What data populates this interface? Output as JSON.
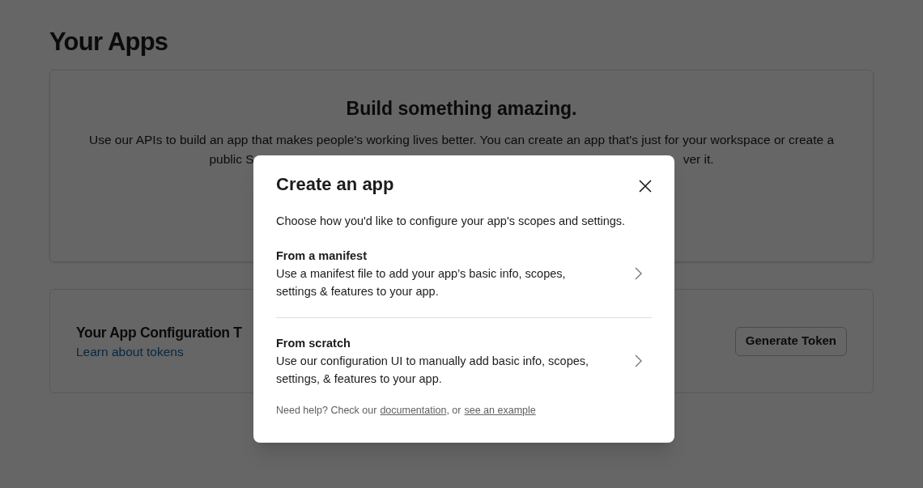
{
  "page": {
    "title": "Your Apps"
  },
  "intro_card": {
    "heading": "Build something amazing.",
    "text_line_1": "Use our APIs to build an app that makes people's working lives better. You can create an app that's just for your workspace or create a",
    "text_line_2_start": "public S",
    "text_line_2_end": "ver it."
  },
  "token_card": {
    "title": "Your App Configuration T",
    "link": "Learn about tokens",
    "button": "Generate Token"
  },
  "modal": {
    "title": "Create an app",
    "subtitle": "Choose how you'd like to configure your app's scopes and settings.",
    "options": [
      {
        "title": "From a manifest",
        "description": "Use a manifest file to add your app’s basic info, scopes, settings & features to your app."
      },
      {
        "title": "From scratch",
        "description": "Use our configuration UI to manually add basic info, scopes, settings, & features to your app."
      }
    ],
    "help": {
      "text": "Need help? Check our",
      "link_1": "documentation",
      "separator": ", or",
      "link_2": "see an example"
    }
  }
}
